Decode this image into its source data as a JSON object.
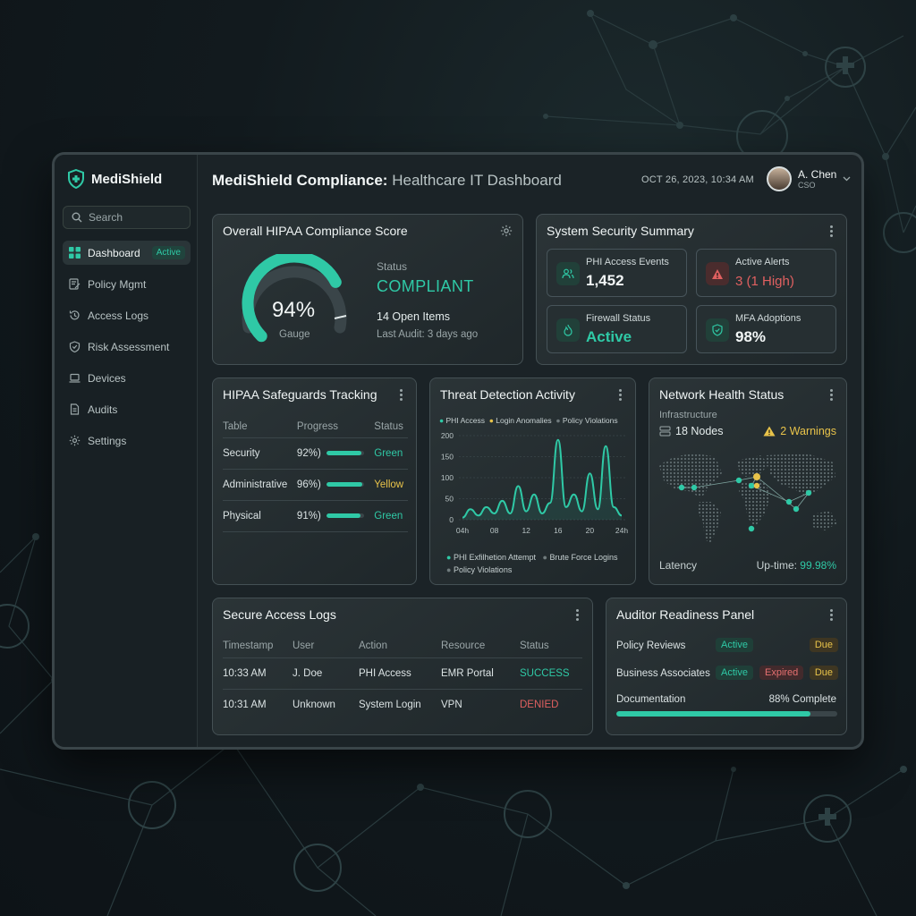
{
  "app": {
    "name": "MediShield"
  },
  "header": {
    "title_bold": "MediShield Compliance:",
    "title_rest": " Healthcare IT Dashboard",
    "datetime": "OCT 26, 2023, 10:34 AM",
    "user_name": "A. Chen",
    "user_role": "CSO"
  },
  "search": {
    "placeholder": "Search"
  },
  "sidebar": {
    "items": [
      {
        "label": "Dashboard",
        "icon": "grid-icon",
        "badge": "Active"
      },
      {
        "label": "Policy Mgmt",
        "icon": "document-edit-icon"
      },
      {
        "label": "Access Logs",
        "icon": "history-icon"
      },
      {
        "label": "Risk Assessment",
        "icon": "shield-check-icon"
      },
      {
        "label": "Devices",
        "icon": "laptop-icon"
      },
      {
        "label": "Audits",
        "icon": "document-icon"
      },
      {
        "label": "Settings",
        "icon": "gear-icon"
      }
    ]
  },
  "compliance": {
    "title": "Overall HIPAA Compliance Score",
    "score": "94%",
    "score_value": 94,
    "gauge_label": "Gauge",
    "status_label": "Status",
    "status_value": "COMPLIANT",
    "open_items": "14 Open Items",
    "last_audit": "Last Audit: 3 days ago"
  },
  "security": {
    "title": "System Security Summary",
    "tiles": [
      {
        "label": "PHI Access Events",
        "value": "1,452",
        "icon": "users-icon",
        "color": "#f2f6f6"
      },
      {
        "label": "Active Alerts",
        "value": "3 (1 High)",
        "icon": "warning-icon",
        "color": "#e06060"
      },
      {
        "label": "Firewall Status",
        "value": "Active",
        "icon": "flame-icon",
        "color": "#2fc9a6"
      },
      {
        "label": "MFA Adoptions",
        "value": "98%",
        "icon": "shield-icon",
        "color": "#f2f6f6"
      }
    ]
  },
  "safeguards": {
    "title": "HIPAA Safeguards Tracking",
    "columns": [
      "Table",
      "Progress",
      "Status"
    ],
    "rows": [
      {
        "name": "Security",
        "progress": "92%)",
        "fill": 0.92,
        "status": "Green"
      },
      {
        "name": "Administrative",
        "progress": "96%)",
        "fill": 0.96,
        "status": "Yellow"
      },
      {
        "name": "Physical",
        "progress": "91%)",
        "fill": 0.91,
        "status": "Green"
      }
    ]
  },
  "threats": {
    "title": "Threat Detection Activity",
    "legend_top": [
      "PHI Access",
      "Login Anomalies",
      "Policy Violations"
    ],
    "legend_bottom": [
      "PHI Exfilhetion Attempt",
      "Brute Force Logins",
      "Policy Violations"
    ],
    "chart_data": {
      "type": "line",
      "x": [
        "04h",
        "08",
        "12",
        "16",
        "20",
        "24h"
      ],
      "yticks": [
        0,
        50,
        100,
        150,
        200
      ],
      "ylim": [
        0,
        200
      ],
      "series": [
        {
          "name": "PHI Access",
          "color": "#2fc9a6",
          "points": [
            [
              0,
              5
            ],
            [
              1,
              25
            ],
            [
              2,
              10
            ],
            [
              3,
              30
            ],
            [
              4,
              15
            ],
            [
              5,
              45
            ],
            [
              6,
              15
            ],
            [
              7,
              80
            ],
            [
              8,
              20
            ],
            [
              9,
              60
            ],
            [
              10,
              15
            ],
            [
              11,
              40
            ],
            [
              12,
              190
            ],
            [
              13,
              30
            ],
            [
              14,
              60
            ],
            [
              15,
              20
            ],
            [
              16,
              110
            ],
            [
              17,
              25
            ],
            [
              18,
              175
            ],
            [
              19,
              30
            ],
            [
              20,
              10
            ]
          ]
        }
      ]
    }
  },
  "network": {
    "title": "Network Health Status",
    "infra_label": "Infrastructure",
    "nodes": "18 Nodes",
    "warnings": "2 Warnings",
    "latency_label": "Latency",
    "uptime_label": "Up-time:",
    "uptime_value": "99.98%"
  },
  "logs": {
    "title": "Secure Access Logs",
    "columns": [
      "Timestamp",
      "User",
      "Action",
      "Resource",
      "Status"
    ],
    "rows": [
      {
        "time": "10:33 AM",
        "user": "J. Doe",
        "action": "PHI Access",
        "resource": "EMR Portal",
        "status": "SUCCESS"
      },
      {
        "time": "10:31 AM",
        "user": "Unknown",
        "action": "System Login",
        "resource": "VPN",
        "status": "DENIED"
      }
    ]
  },
  "auditor": {
    "title": "Auditor Readiness Panel",
    "rows": [
      {
        "label": "Policy Reviews",
        "badges": [
          "Active",
          "Due"
        ]
      },
      {
        "label": "Business Associates",
        "badges": [
          "Active",
          "Expired",
          "Due"
        ]
      }
    ],
    "doc_label": "Documentation",
    "doc_value": "88% Complete",
    "doc_fill": 0.88
  }
}
